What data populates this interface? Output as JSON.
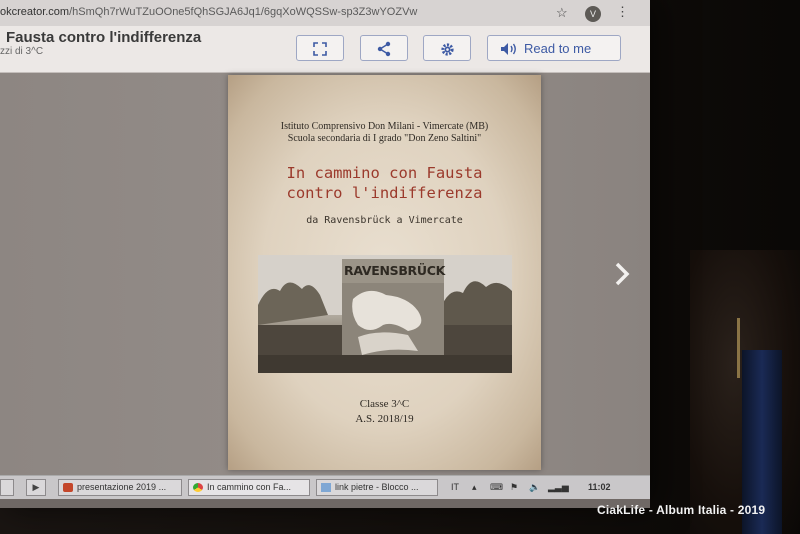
{
  "browser": {
    "url_prefix": "okcreator.com",
    "url_rest": "/hSmQh7rWuTZuOOne5fQhSGJA6Jq1/6gqXoWQSSw-sp3Z3wYOZVw",
    "avatar_letter": "V"
  },
  "app": {
    "title": "Fausta contro l'indifferenza",
    "subtitle": "zzi di 3^C",
    "read_label": "Read to me"
  },
  "cover": {
    "school_line1": "Istituto Comprensivo Don Milani - Vimercate (MB)",
    "school_line2": "Scuola secondaria di I grado \"Don Zeno Saltini\"",
    "title_line1": "In cammino con Fausta",
    "title_line2": "contro l'indifferenza",
    "subtitle": "da Ravensbrück a Vimercate",
    "sign_text": "RAVENSBRÜCK",
    "class_label": "Classe 3^C",
    "year_label": "A.S. 2018/19"
  },
  "taskbar": {
    "tasks": [
      {
        "label": "presentazione 2019 ...",
        "icon": "powerpoint-icon"
      },
      {
        "label": "In cammino con Fa...",
        "icon": "chrome-icon"
      },
      {
        "label": "link pietre - Blocco ...",
        "icon": "notepad-icon"
      }
    ],
    "language": "IT",
    "clock": "11:02"
  },
  "watermark": "CiakLife - Album Italia - 2019",
  "colors": {
    "accent_blue": "#3d5aa4",
    "cover_title_red": "#9b3a2c"
  }
}
